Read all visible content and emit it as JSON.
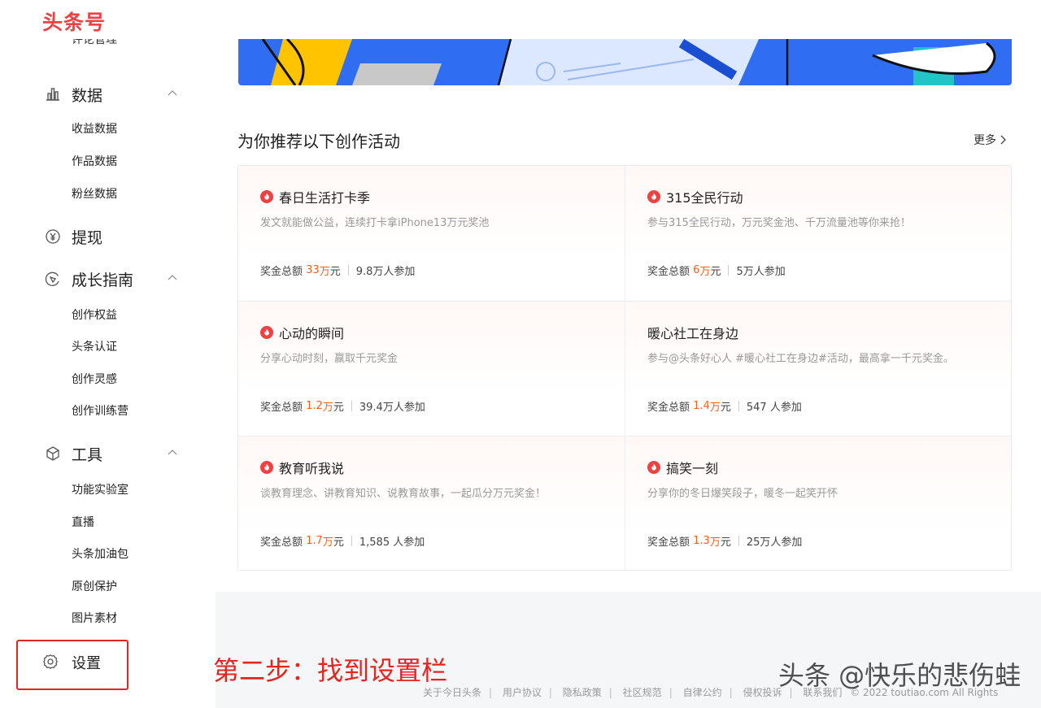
{
  "header": {
    "logo": "头条号"
  },
  "sidebar": {
    "clipped_label": "评论管理",
    "groups": [
      {
        "label": "数据",
        "icon": "bar-chart-icon",
        "items": [
          "收益数据",
          "作品数据",
          "粉丝数据"
        ]
      },
      {
        "label": "提现",
        "icon": "yen-circle-icon"
      },
      {
        "label": "成长指南",
        "icon": "compass-icon",
        "items": [
          "创作权益",
          "头条认证",
          "创作灵感",
          "创作训练营"
        ]
      },
      {
        "label": "工具",
        "icon": "cube-icon",
        "items": [
          "功能实验室",
          "直播",
          "头条加油包",
          "原创保护",
          "图片素材"
        ]
      }
    ],
    "settings": {
      "label": "设置",
      "icon": "gear-icon"
    }
  },
  "main": {
    "section_title": "为你推荐以下创作活动",
    "more_label": "更多",
    "activities": [
      {
        "title": "春日生活打卡季",
        "desc": "发文就能做公益，连续打卡拿iPhone13万元奖池",
        "prize_label": "奖金总额",
        "prize_num": "33",
        "prize_unit": "万",
        "prize_suffix": "元",
        "participants": "9.8万人参加",
        "hot": true
      },
      {
        "title": "315全民行动",
        "desc": "参与315全民行动，万元奖金池、千万流量池等你来抢！",
        "prize_label": "奖金总额",
        "prize_num": "6",
        "prize_unit": "万",
        "prize_suffix": "元",
        "participants": "5万人参加",
        "hot": true
      },
      {
        "title": "心动的瞬间",
        "desc": "分享心动时刻，赢取千元奖金",
        "prize_label": "奖金总额",
        "prize_num": "1.2",
        "prize_unit": "万",
        "prize_suffix": "元",
        "participants": "39.4万人参加",
        "hot": true
      },
      {
        "title": "暖心社工在身边",
        "desc": "参与@头条好心人 #暖心社工在身边#活动，最高拿一千元奖金。",
        "prize_label": "奖金总额",
        "prize_num": "1.4",
        "prize_unit": "万",
        "prize_suffix": "元",
        "participants": "547 人参加",
        "hot": false
      },
      {
        "title": "教育听我说",
        "desc": "谈教育理念、讲教育知识、说教育故事，一起瓜分万元奖金！",
        "prize_label": "奖金总额",
        "prize_num": "1.7",
        "prize_unit": "万",
        "prize_suffix": "元",
        "participants": "1,585 人参加",
        "hot": true
      },
      {
        "title": "搞笑一刻",
        "desc": "分享你的冬日爆笑段子，暖冬一起笑开怀",
        "prize_label": "奖金总额",
        "prize_num": "1.3",
        "prize_unit": "万",
        "prize_suffix": "元",
        "participants": "25万人参加",
        "hot": true
      }
    ]
  },
  "annotation": "第二步：找到设置栏",
  "watermark": "头条 @快乐的悲伤蛙",
  "footer": {
    "links": [
      "关于今日头条",
      "用户协议",
      "隐私政策",
      "社区规范",
      "自律公约",
      "侵权投诉",
      "联系我们"
    ],
    "copyright": "© 2022 toutiao.com All Rights"
  },
  "colors": {
    "brand": "#f04142",
    "highlight": "#f85e16",
    "annotation": "#e4241f"
  }
}
